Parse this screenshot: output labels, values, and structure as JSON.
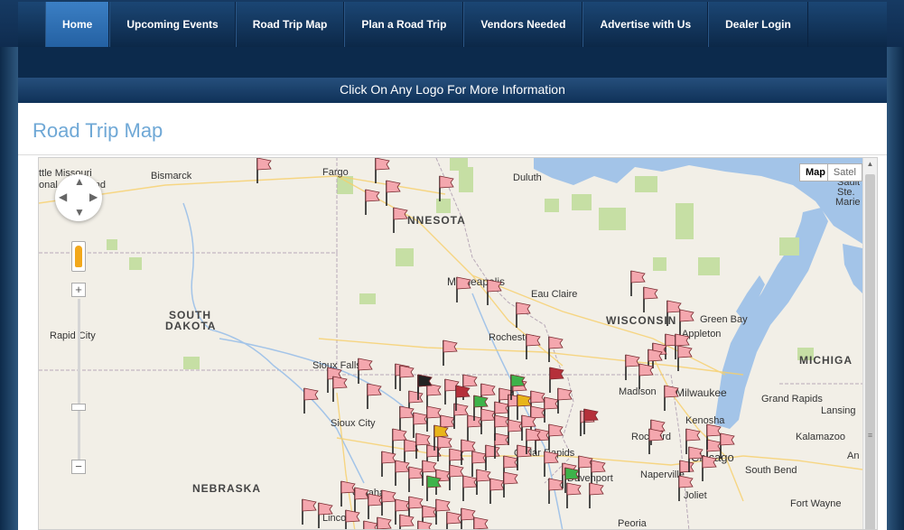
{
  "nav": {
    "items": [
      {
        "label": "Home",
        "active": true
      },
      {
        "label": "Upcoming Events",
        "active": false
      },
      {
        "label": "Road Trip Map",
        "active": false
      },
      {
        "label": "Plan a Road Trip",
        "active": false
      },
      {
        "label": "Vendors Needed",
        "active": false
      },
      {
        "label": "Advertise with Us",
        "active": false
      },
      {
        "label": "Dealer Login",
        "active": false
      }
    ]
  },
  "info_banner": "Click On Any Logo For More Information",
  "page_title": "Road Trip Map",
  "map": {
    "type_buttons": {
      "map": "Map",
      "satellite": "Satel"
    },
    "zoom_in": "+",
    "zoom_out": "−",
    "state_labels": {
      "minnesota": "NNESOTA",
      "south_dakota_1": "SOUTH",
      "south_dakota_2": "DAKOTA",
      "wisconsin": "WISCONSIN",
      "nebraska": "NEBRASKA",
      "michigan": "MICHIGA",
      "north_dakota": "DAKOTA"
    },
    "city_labels": {
      "bismarck": "Bismarck",
      "fargo": "Fargo",
      "duluth": "Duluth",
      "little_missouri": "ttle Missouri",
      "national_grassland": "onal Grassland",
      "sault_ste_marie_1": "Sault",
      "sault_ste_marie_2": "Ste.",
      "sault_ste_marie_3": "Marie",
      "minneapolis": "Minneapolis",
      "eau_claire": "Eau Claire",
      "green_bay": "Green Bay",
      "appleton": "Appleton",
      "rapid_city": "Rapid City",
      "rochester": "Rochester",
      "sioux_falls": "Sioux Falls",
      "madison": "Madison",
      "milwaukee": "Milwaukee",
      "grand_rapids": "Grand Rapids",
      "sioux_city": "Sioux City",
      "lansing": "Lansing",
      "kenosha": "Kenosha",
      "rockford": "Rockford",
      "kalamazoo": "Kalamazoo",
      "cedar_rapids": "Cedar Rapids",
      "davenport": "Davenport",
      "chicago": "Chicago",
      "naperville": "Naperville",
      "south_bend": "South Bend",
      "omaha": "Omaha",
      "joliet": "Joliet",
      "lincoln": "Lincoln",
      "fort_wayne": "Fort Wayne",
      "peoria": "Peoria",
      "ann_arbor": "An"
    },
    "colors": {
      "land": "#f2efe7",
      "water": "#a3c4e8",
      "park": "#c6dfa4",
      "flag_pink": "#f4a7ae",
      "flag_red": "#b5303a",
      "flag_green": "#3db34a",
      "flag_yellow": "#e8b51a",
      "flag_black": "#222222",
      "pole": "#222222"
    }
  }
}
